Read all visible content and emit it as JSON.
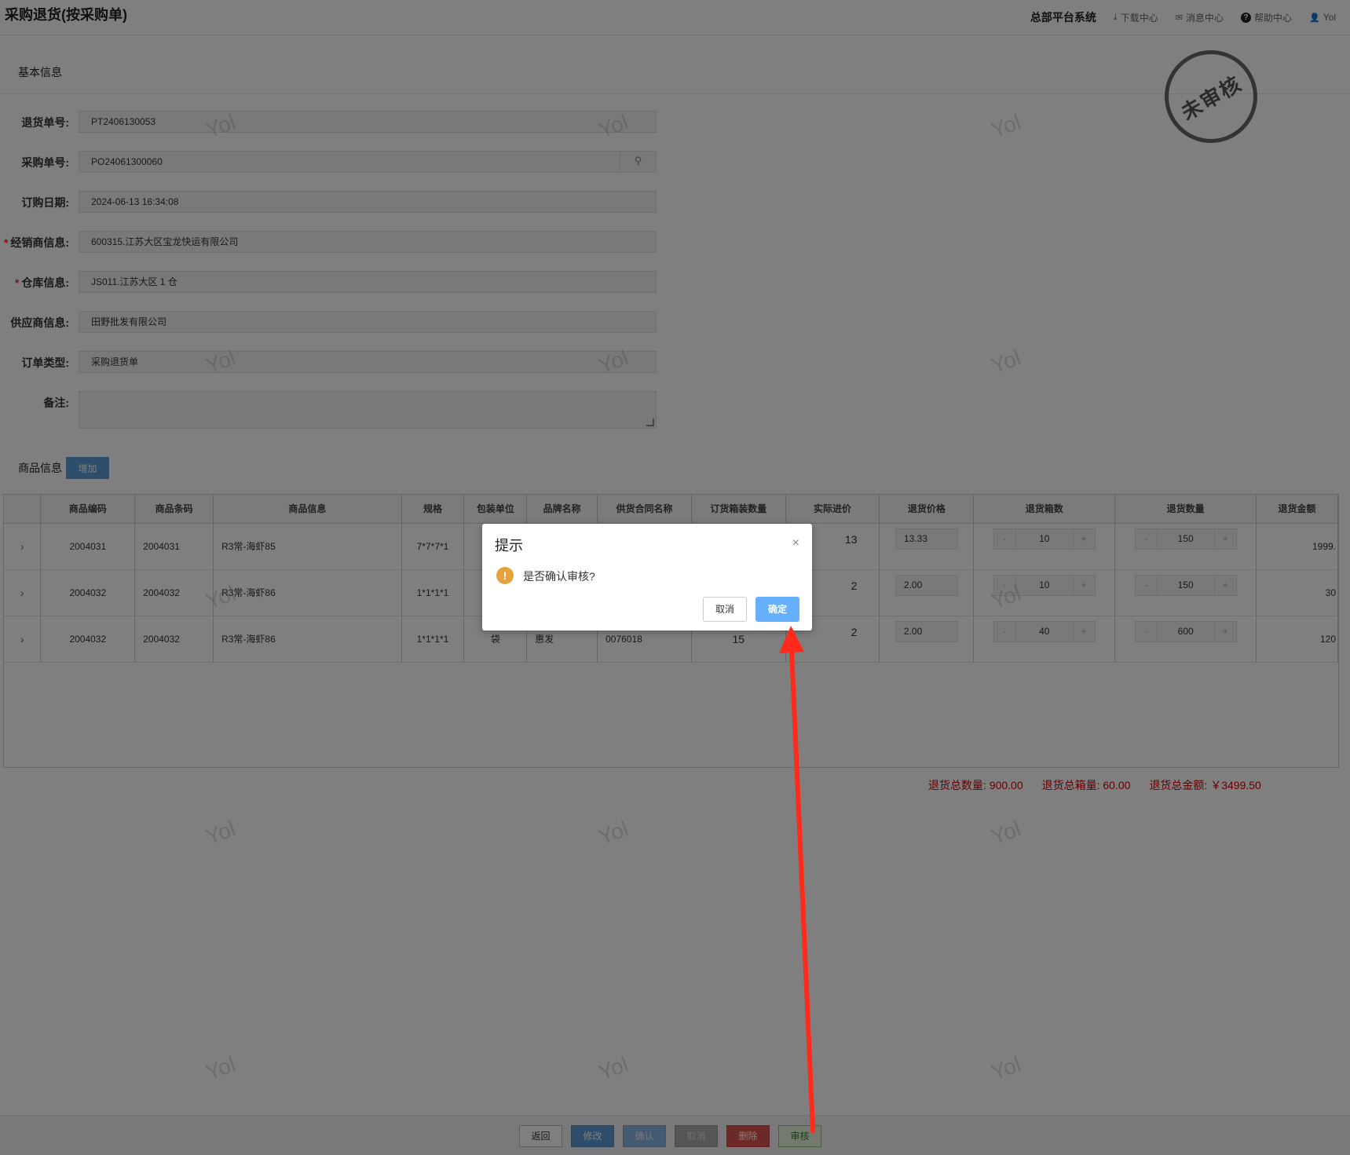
{
  "header": {
    "title": "采购退货(按采购单)",
    "system_name": "总部平台系统",
    "links": [
      {
        "label": "下载中心",
        "icon": "download-icon"
      },
      {
        "label": "消息中心",
        "icon": "mail-icon"
      },
      {
        "label": "帮助中心",
        "icon": "help-icon"
      }
    ],
    "user": "Yol"
  },
  "basic_info": {
    "section_label": "基本信息",
    "stamp_text": "未审核",
    "fields": {
      "return_no": {
        "label": "退货单号:",
        "value": "PT2406130053"
      },
      "purchase_no": {
        "label": "采购单号:",
        "value": "PO24061300060"
      },
      "order_date": {
        "label": "订购日期:",
        "value": "2024-06-13 16:34:08"
      },
      "dealer": {
        "label": "经销商信息:",
        "value": "600315.江苏大区宝龙快运有限公司",
        "required": "*"
      },
      "warehouse": {
        "label": "仓库信息:",
        "value": "JS011.江苏大区 1 仓",
        "required": "*"
      },
      "supplier": {
        "label": "供应商信息:",
        "value": "田野批发有限公司"
      },
      "order_type": {
        "label": "订单类型:",
        "value": "采购退货单"
      },
      "remark": {
        "label": "备注:",
        "value": ""
      }
    }
  },
  "goods": {
    "section_label": "商品信息",
    "add_label": "增加",
    "columns": [
      "商品编码",
      "商品条码",
      "商品信息",
      "规格",
      "包装单位",
      "品牌名称",
      "供货合同名称",
      "订货箱装数量",
      "实际进价",
      "退货价格",
      "退货箱数",
      "退货数量",
      "退货金额"
    ],
    "rows": [
      {
        "code": "2004031",
        "barcode": "2004031",
        "info": "R3常-海虾85",
        "spec": "7*7*7*1",
        "unit": "",
        "brand": "",
        "contract": "",
        "box_qty": "",
        "actual_price": "13",
        "return_price": "13.33",
        "boxes": "10",
        "qty": "150",
        "amount": "1999."
      },
      {
        "code": "2004032",
        "barcode": "2004032",
        "info": "R3常-海虾86",
        "spec": "1*1*1*1",
        "unit": "",
        "brand": "",
        "contract": "",
        "box_qty": "",
        "actual_price": "2",
        "return_price": "2.00",
        "boxes": "10",
        "qty": "150",
        "amount": "30"
      },
      {
        "code": "2004032",
        "barcode": "2004032",
        "info": "R3常-海虾86",
        "spec": "1*1*1*1",
        "unit": "袋",
        "brand": "惠发",
        "contract": "0076018",
        "box_qty": "15",
        "actual_price": "2",
        "return_price": "2.00",
        "boxes": "40",
        "qty": "600",
        "amount": "120"
      }
    ],
    "stepper_minus": "-",
    "stepper_plus": "+",
    "expand_glyph": "›"
  },
  "totals": {
    "qty": "退货总数量: 900.00",
    "boxes": "退货总箱量: 60.00",
    "amount": "退货总金额: ￥3499.50"
  },
  "watermark": "Yol",
  "footer": {
    "back": "返回",
    "edit": "修改",
    "confirm": "确认",
    "cancel": "取消",
    "delete": "删除",
    "audit": "审核"
  },
  "dialog": {
    "title": "提示",
    "close_glyph": "×",
    "message": "是否确认审核?",
    "cancel": "取消",
    "ok": "确定"
  },
  "colors": {
    "edit_btn": "#5b9bd5",
    "confirm_btn": "#88b4e0",
    "cancel_btn": "#aaaaaa",
    "delete_btn": "#d9534f",
    "audit_btn": "#e8f5e0",
    "ok_btn": "#66b1ff",
    "totals_text": "#cc0000",
    "arrow": "#ff2a1a"
  }
}
